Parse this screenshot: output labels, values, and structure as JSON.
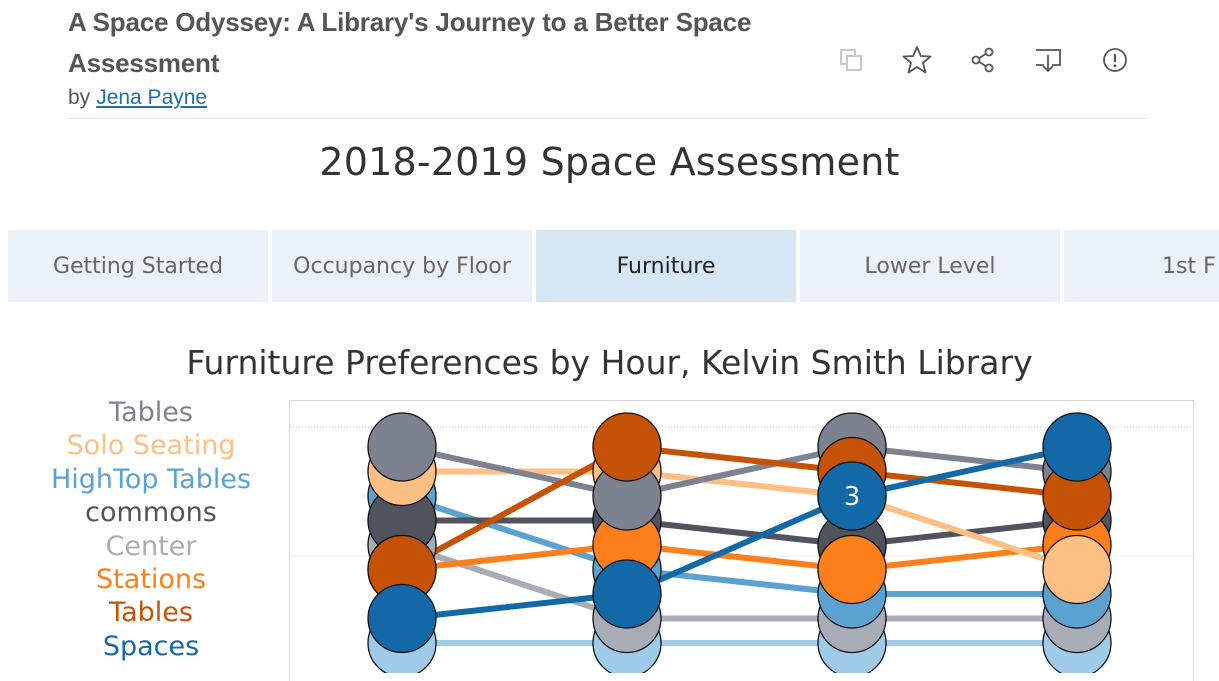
{
  "header": {
    "title": "A Space Odyssey: A Library's Journey to a Better Space Assessment",
    "by_label": "by",
    "author": "Jena Payne"
  },
  "toolbar": [
    {
      "name": "copy-icon"
    },
    {
      "name": "star-icon"
    },
    {
      "name": "share-icon"
    },
    {
      "name": "download-icon"
    },
    {
      "name": "info-icon"
    }
  ],
  "dashboard": {
    "title": "2018-2019 Space Assessment",
    "tabs": [
      {
        "label": "Getting Started",
        "active": false
      },
      {
        "label": "Occupancy by Floor",
        "active": false
      },
      {
        "label": "Furniture",
        "active": true
      },
      {
        "label": "Lower Level",
        "active": false
      },
      {
        "label": "1st F",
        "active": false
      }
    ]
  },
  "colors": {
    "tables_gray": "#7c8290",
    "solo_seating": "#fdbf84",
    "hightop_tables": "#5ca2d1",
    "commons": "#50545f",
    "center": "#a8adb5",
    "stations": "#fd7f1c",
    "tables_orange": "#c65205",
    "spaces": "#1369a8",
    "light_blue": "#9fcbe8"
  },
  "chart_data": {
    "type": "line",
    "title": "Furniture Preferences by Hour, Kelvin Smith Library",
    "label_shown": "3",
    "series": [
      {
        "name": "Tables",
        "color": "#7c8290",
        "ranks": [
          1,
          3,
          1,
          2
        ]
      },
      {
        "name": "Solo Seating",
        "color": "#fdbf84",
        "ranks": [
          2,
          2,
          3,
          6
        ]
      },
      {
        "name": "HighTop Tables",
        "color": "#5ca2d1",
        "ranks": [
          3,
          6,
          7,
          7
        ]
      },
      {
        "name": "commons",
        "color": "#50545f",
        "ranks": [
          4,
          4,
          5,
          4
        ]
      },
      {
        "name": "Center",
        "color": "#a8adb5",
        "ranks": [
          5,
          8,
          8,
          8
        ]
      },
      {
        "name": "Stations",
        "color": "#fd7f1c",
        "ranks": [
          6,
          5,
          6,
          5
        ]
      },
      {
        "name": "Tables",
        "color": "#c65205",
        "ranks": [
          6,
          1,
          2,
          3
        ]
      },
      {
        "name": "Spaces",
        "color": "#1369a8",
        "ranks": [
          8,
          7,
          3,
          1
        ]
      },
      {
        "name": "",
        "color": "#9fcbe8",
        "ranks": [
          9,
          9,
          9,
          9
        ]
      }
    ]
  }
}
